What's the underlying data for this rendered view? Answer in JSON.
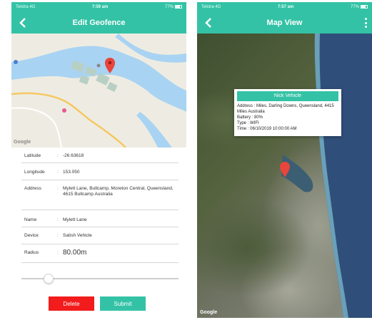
{
  "left_screen": {
    "status": {
      "carrier": "Telstra 4G",
      "time": "7:59 am",
      "battery": "77%"
    },
    "title": "Edit Geofence",
    "map": {
      "google_label": "Google"
    },
    "form": {
      "latitude_label": "Latitude",
      "latitude_value": "-26.63618",
      "longitude_label": "Longitude",
      "longitude_value": "153.050",
      "address_label": "Address",
      "address_value": "Mylett Lane, Bullcamp, Moreton Central, Queensland, 4615 Bullcamp Australia",
      "name_label": "Name",
      "name_value": "Mylett Lane",
      "device_label": "Device",
      "device_value": "Satish Vehicle",
      "radius_label": "Radius",
      "radius_value": "80.00m",
      "separator": ":"
    },
    "slider": {
      "value_fraction": 0.15
    },
    "buttons": {
      "delete": "Delete",
      "submit": "Submit"
    }
  },
  "right_screen": {
    "status": {
      "carrier": "Telstra 4G",
      "time": "7:57 am",
      "battery": "77%"
    },
    "title": "Map View",
    "google_label": "Google",
    "info": {
      "title": "Nick Vehicle",
      "address": "Address : Miles, Darling Downs, Queensland, 4415 Miles Australia",
      "battery": "Battery : 80%",
      "type": "Type : WIFI",
      "time": "Time : 06/10/2019 10:00:00 AM"
    }
  },
  "colors": {
    "accent": "#34c2a6",
    "delete": "#f21c1c",
    "marker": "#e8453c"
  }
}
